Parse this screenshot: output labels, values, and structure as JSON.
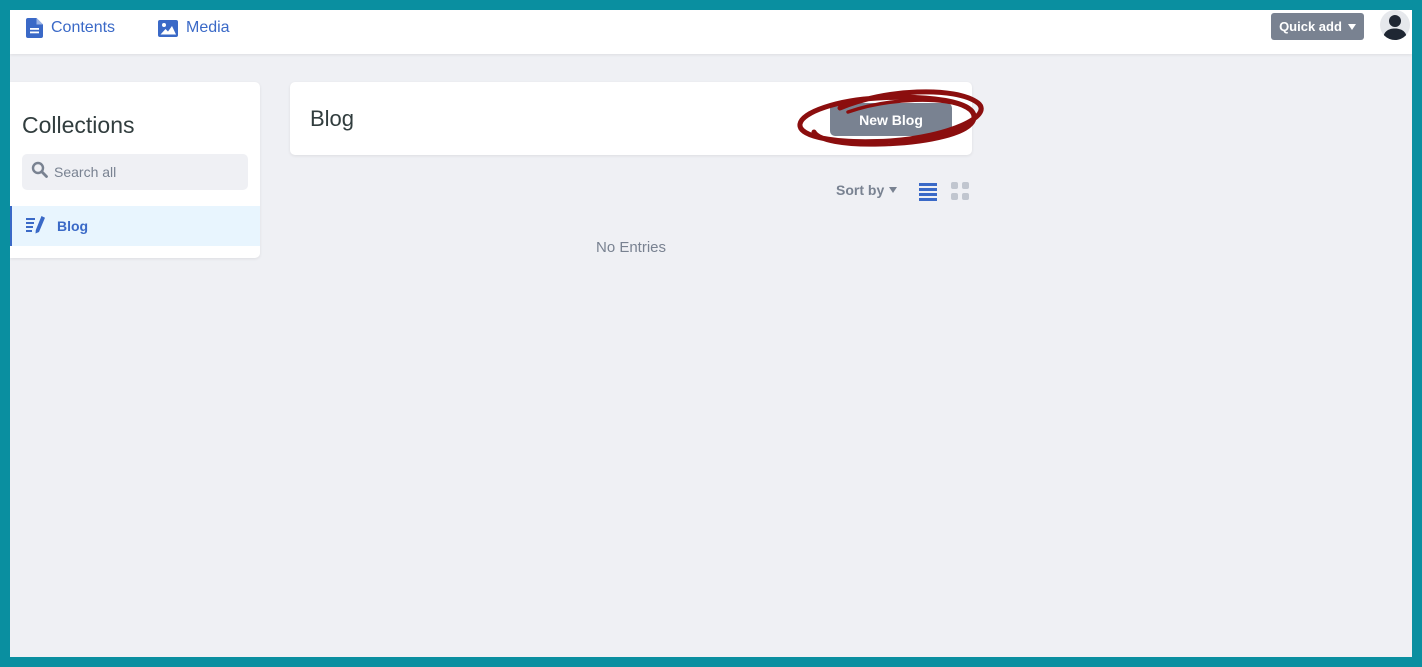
{
  "nav": {
    "contents_label": "Contents",
    "media_label": "Media",
    "quick_add_label": "Quick add"
  },
  "sidebar": {
    "title": "Collections",
    "search_placeholder": "Search all",
    "items": [
      {
        "label": "Blog",
        "active": true
      }
    ]
  },
  "main": {
    "collection_title": "Blog",
    "new_button_label": "New Blog",
    "sort_label": "Sort by",
    "view_mode": "list",
    "empty_text": "No Entries"
  },
  "colors": {
    "accent": "#3a69c7",
    "button_gray": "#798291",
    "highlight_annotation": "#8b0e0e",
    "frame_border": "#0a8fa0",
    "background": "#eff0f4"
  },
  "icons": [
    "document-icon",
    "image-icon",
    "chevron-down-icon",
    "user-avatar-icon",
    "search-icon",
    "pen-list-icon",
    "list-view-icon",
    "grid-view-icon"
  ]
}
